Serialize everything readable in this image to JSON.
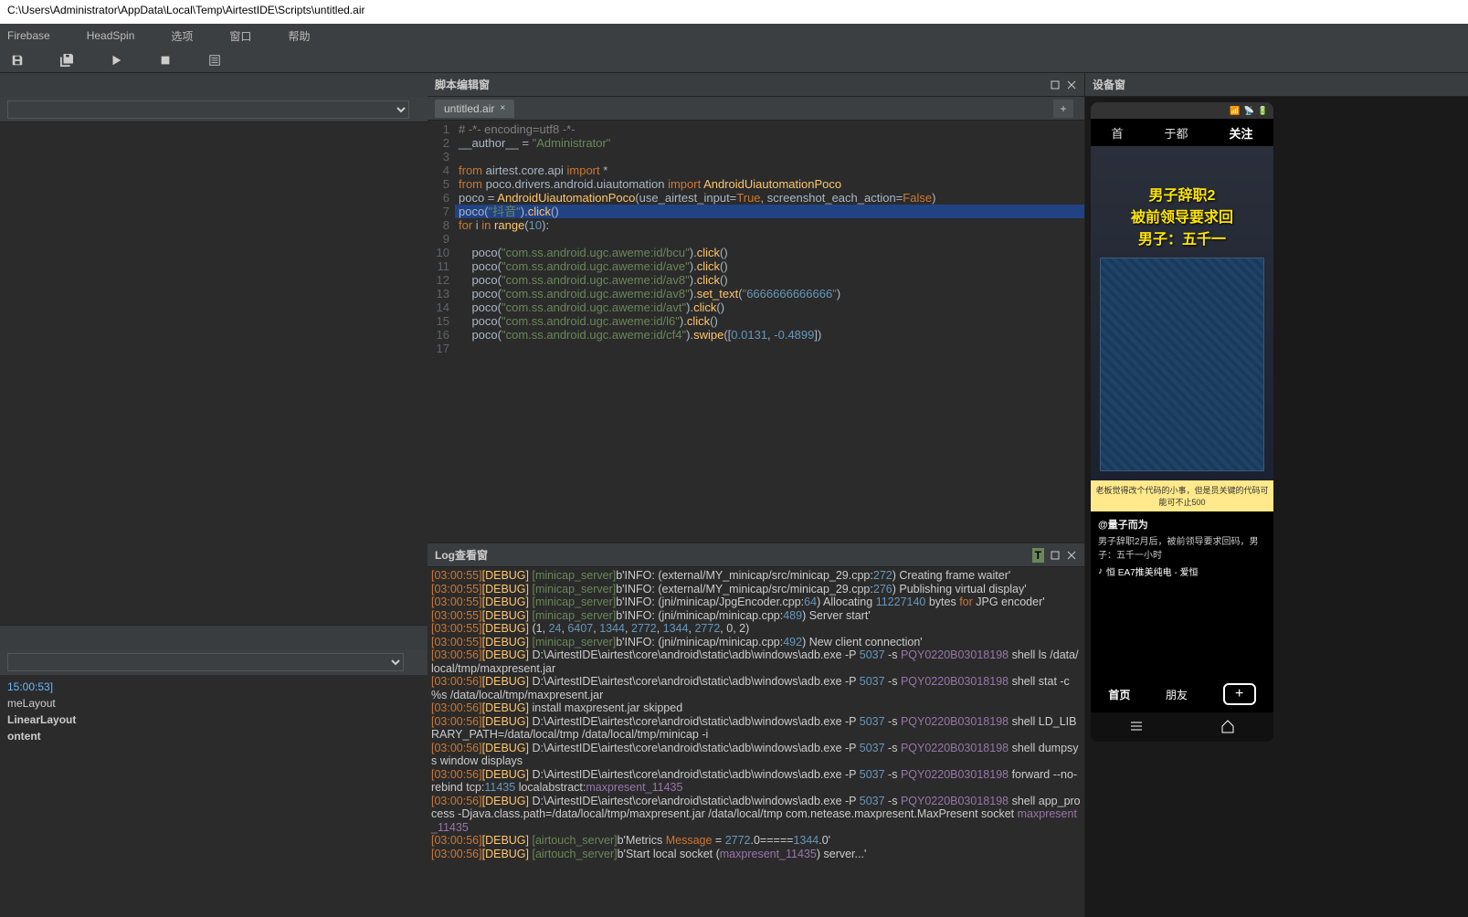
{
  "titlebar": "C:\\Users\\Administrator\\AppData\\Local\\Temp\\AirtestIDE\\Scripts\\untitled.air",
  "menubar": [
    "Firebase",
    "HeadSpin",
    "选项",
    "窗口",
    "帮助"
  ],
  "panels": {
    "script": {
      "title": "脚本编辑窗"
    },
    "log": {
      "title": "Log查看窗"
    },
    "device": {
      "title": "设备窗"
    }
  },
  "tab": {
    "name": "untitled.air"
  },
  "code": {
    "lines": [
      {
        "n": 1,
        "t": "# -*- encoding=utf8 -*-",
        "cls": "com"
      },
      {
        "n": 2,
        "t": "__author__ = \"Administrator\""
      },
      {
        "n": 3,
        "t": ""
      },
      {
        "n": 4,
        "t": "from airtest.core.api import *"
      },
      {
        "n": 5,
        "t": "from poco.drivers.android.uiautomation import AndroidUiautomationPoco"
      },
      {
        "n": 6,
        "t": "poco = AndroidUiautomationPoco(use_airtest_input=True, screenshot_each_action=False)"
      },
      {
        "n": 7,
        "t": "poco(\"抖音\").click()",
        "hl": true
      },
      {
        "n": 8,
        "t": "for i in range(10):"
      },
      {
        "n": 9,
        "t": ""
      },
      {
        "n": 10,
        "t": "    poco(\"com.ss.android.ugc.aweme:id/bcu\").click()"
      },
      {
        "n": 11,
        "t": "    poco(\"com.ss.android.ugc.aweme:id/ave\").click()"
      },
      {
        "n": 12,
        "t": "    poco(\"com.ss.android.ugc.aweme:id/av8\").click()"
      },
      {
        "n": 13,
        "t": "    poco(\"com.ss.android.ugc.aweme:id/av8\").set_text(\"6666666666666\")"
      },
      {
        "n": 14,
        "t": "    poco(\"com.ss.android.ugc.aweme:id/avt\").click()"
      },
      {
        "n": 15,
        "t": "    poco(\"com.ss.android.ugc.aweme:id/l6\").click()"
      },
      {
        "n": 16,
        "t": "    poco(\"com.ss.android.ugc.aweme:id/cf4\").swipe([0.0131, -0.4899])"
      },
      {
        "n": 17,
        "t": ""
      }
    ]
  },
  "left_tree": {
    "time": "15:00:53]",
    "nodes": [
      "meLayout",
      "LinearLayout",
      "ontent"
    ]
  },
  "log": {
    "lines": [
      "[03:00:55][DEBUG]<airtest.utils.nbsp> [minicap_server]b'INFO: (external/MY_minicap/src/minicap_29.cpp:272) Creating frame waiter'",
      "[03:00:55][DEBUG]<airtest.utils.nbsp> [minicap_server]b'INFO: (external/MY_minicap/src/minicap_29.cpp:276) Publishing virtual display'",
      "[03:00:55][DEBUG]<airtest.utils.nbsp> [minicap_server]b'INFO: (jni/minicap/JpgEncoder.cpp:64) Allocating 11227140 bytes for JPG encoder'",
      "[03:00:55][DEBUG]<airtest.utils.nbsp> [minicap_server]b'INFO: (jni/minicap/minicap.cpp:489) Server start'",
      "[03:00:55][DEBUG]<airtest.core.android.minicap> (1, 24, 6407, 1344, 2772, 1344, 2772, 0, 2)",
      "[03:00:55][DEBUG]<airtest.utils.nbsp> [minicap_server]b'INFO: (jni/minicap/minicap.cpp:492) New client connection'",
      "[03:00:56][DEBUG]<airtest.core.android.adb> D:\\AirtestIDE\\airtest\\core\\android\\static\\adb\\windows\\adb.exe -P 5037 -s PQY0220B03018198 shell ls /data/local/tmp/maxpresent.jar",
      "[03:00:56][DEBUG]<airtest.core.android.adb> D:\\AirtestIDE\\airtest\\core\\android\\static\\adb\\windows\\adb.exe -P 5037 -s PQY0220B03018198 shell stat -c %s /data/local/tmp/maxpresent.jar",
      "[03:00:56][DEBUG]<airtest.core.android.touch_methods.maxtouch> install maxpresent.jar skipped",
      "[03:00:56][DEBUG]<airtest.core.android.adb> D:\\AirtestIDE\\airtest\\core\\android\\static\\adb\\windows\\adb.exe -P 5037 -s PQY0220B03018198 shell LD_LIBRARY_PATH=/data/local/tmp /data/local/tmp/minicap -i",
      "[03:00:56][DEBUG]<airtest.core.android.adb> D:\\AirtestIDE\\airtest\\core\\android\\static\\adb\\windows\\adb.exe -P 5037 -s PQY0220B03018198 shell dumpsys window displays",
      "[03:00:56][DEBUG]<airtest.core.android.adb> D:\\AirtestIDE\\airtest\\core\\android\\static\\adb\\windows\\adb.exe -P 5037 -s PQY0220B03018198 forward --no-rebind tcp:11435 localabstract:maxpresent_11435",
      "[03:00:56][DEBUG]<airtest.core.android.adb> D:\\AirtestIDE\\airtest\\core\\android\\static\\adb\\windows\\adb.exe -P 5037 -s PQY0220B03018198 shell app_process -Djava.class.path=/data/local/tmp/maxpresent.jar /data/local/tmp com.netease.maxpresent.MaxPresent socket maxpresent_11435",
      "[03:00:56][DEBUG]<airtest.utils.nbsp> [airtouch_server]b'Metrics Message = 2772.0=====1344.0'",
      "[03:00:56][DEBUG]<airtest.utils.nbsp> [airtouch_server]b'Start local socket (maxpresent_11435) server...'"
    ]
  },
  "phone": {
    "tabs": [
      "首",
      "于都",
      "关注"
    ],
    "headline1": "男子辞职2",
    "headline2": "被前领导要求回",
    "headline3": "男子：五千一",
    "caption": "老板觉得改个代码的小事，但是员关键的代码可能可不止500",
    "author": "@量子而为",
    "desc": "男子辞职2月后，被前领导要求回码，男子：五千一小时",
    "music_label": "恒   EA7推美纯电 - 爱恒",
    "nav": [
      "首页",
      "朋友"
    ]
  }
}
